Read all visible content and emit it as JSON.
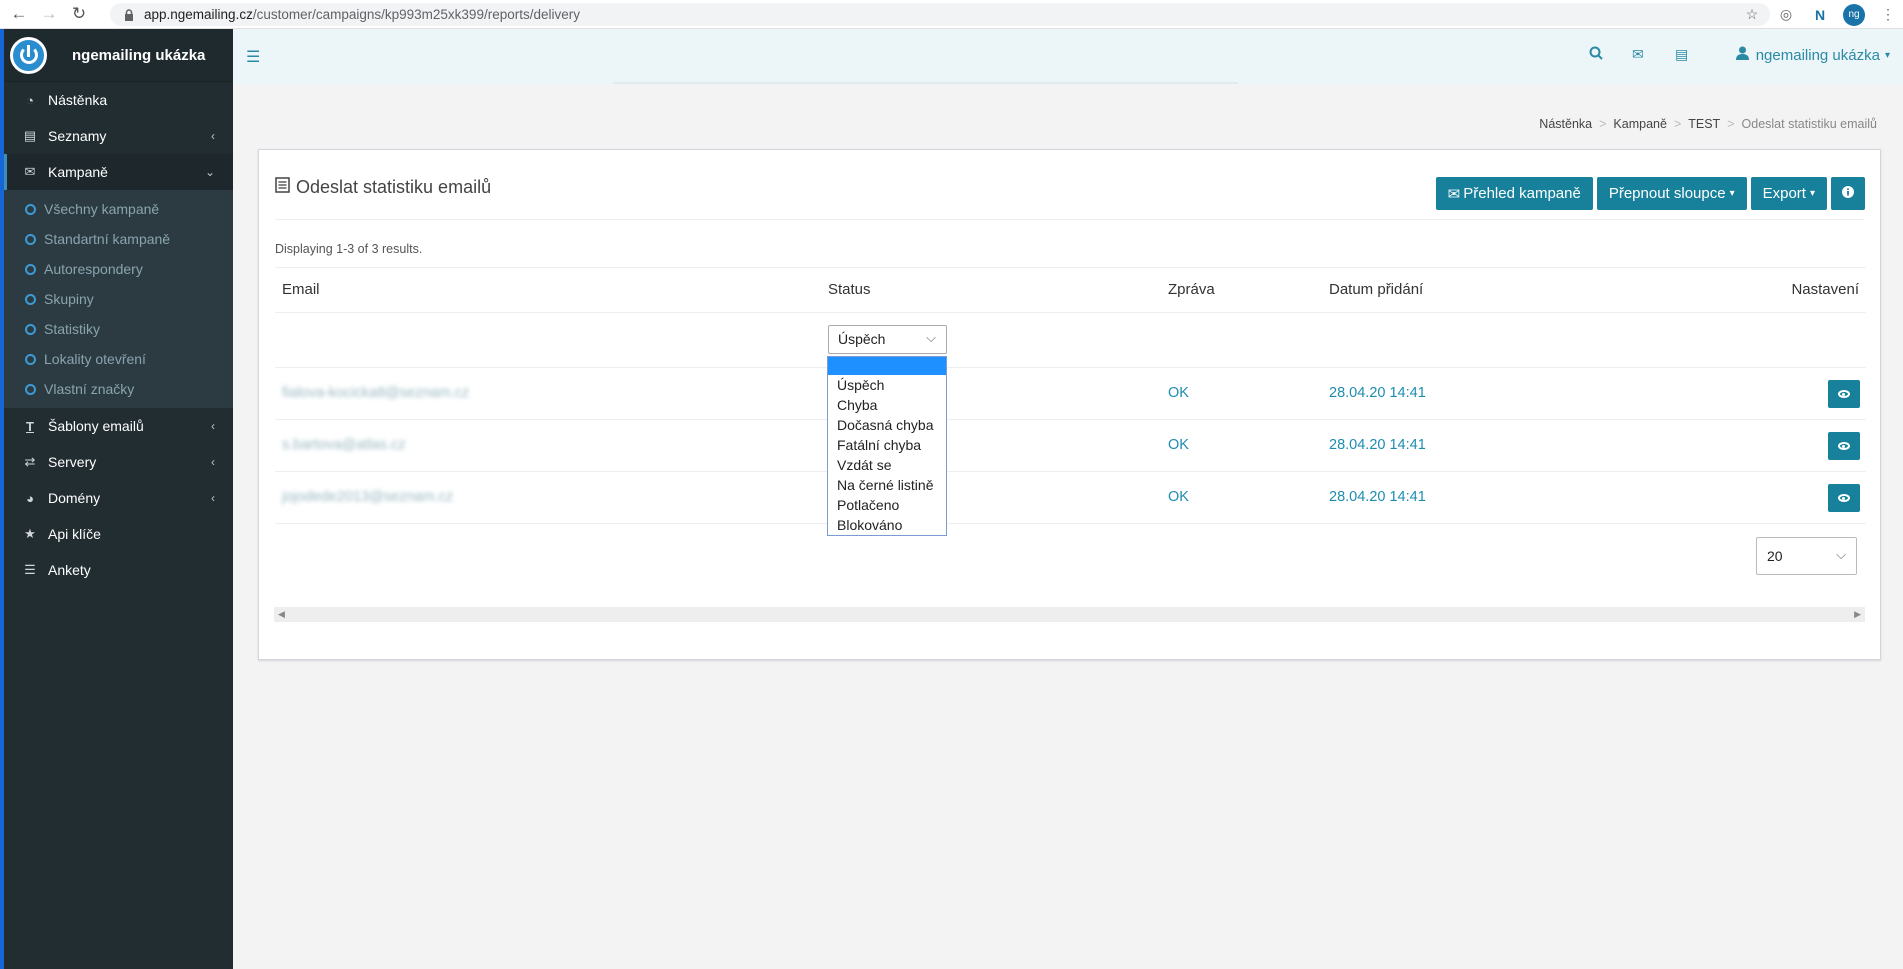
{
  "browser": {
    "url_host": "app.ngemailing.cz",
    "url_path": "/customer/campaigns/kp993m25xk399/reports/delivery",
    "profile_initials": "ng"
  },
  "sidebar": {
    "brand": "ngemailing ukázka",
    "items": [
      {
        "label": "Nástěnka",
        "icon": "dashboard-icon"
      },
      {
        "label": "Seznamy",
        "icon": "list-icon"
      },
      {
        "label": "Kampaně",
        "icon": "envelope-icon"
      },
      {
        "label": "Šablony emailů",
        "icon": "text-icon"
      },
      {
        "label": "Servery",
        "icon": "exchange-icon"
      },
      {
        "label": "Domény",
        "icon": "globe-icon"
      },
      {
        "label": "Api klíče",
        "icon": "star-icon"
      },
      {
        "label": "Ankety",
        "icon": "list-icon"
      }
    ],
    "sub_items": [
      "Všechny kampaně",
      "Standartní kampaně",
      "Autorespondery",
      "Skupiny",
      "Statistiky",
      "Lokality otevření",
      "Vlastní značky"
    ]
  },
  "topbar": {
    "user": "ngemailing ukázka"
  },
  "breadcrumb": {
    "items": [
      "Nástěnka",
      "Kampaně",
      "TEST"
    ],
    "current": "Odeslat statistiku emailů"
  },
  "card": {
    "title": "Odeslat statistiku emailů",
    "buttons": {
      "overview": "Přehled kampaně",
      "columns": "Přepnout sloupce",
      "export": "Export"
    },
    "displaying": "Displaying 1-3 of 3 results."
  },
  "table": {
    "headers": {
      "email": "Email",
      "status": "Status",
      "message": "Zpráva",
      "date": "Datum přidání",
      "settings": "Nastavení"
    },
    "status_filter": "Úspěch",
    "rows": [
      {
        "email": "fialova-kocicka8@seznam.cz",
        "message": "OK",
        "date": "28.04.20 14:41"
      },
      {
        "email": "s.bartova@atlas.cz",
        "message": "OK",
        "date": "28.04.20 14:41"
      },
      {
        "email": "jojodede2013@seznam.cz",
        "message": "OK",
        "date": "28.04.20 14:41"
      }
    ]
  },
  "dropdown": {
    "options": [
      "Úspěch",
      "Chyba",
      "Dočasná chyba",
      "Fatální chyba",
      "Vzdát se",
      "Na černé listině",
      "Potlačeno",
      "Blokováno"
    ]
  },
  "page_size": "20"
}
